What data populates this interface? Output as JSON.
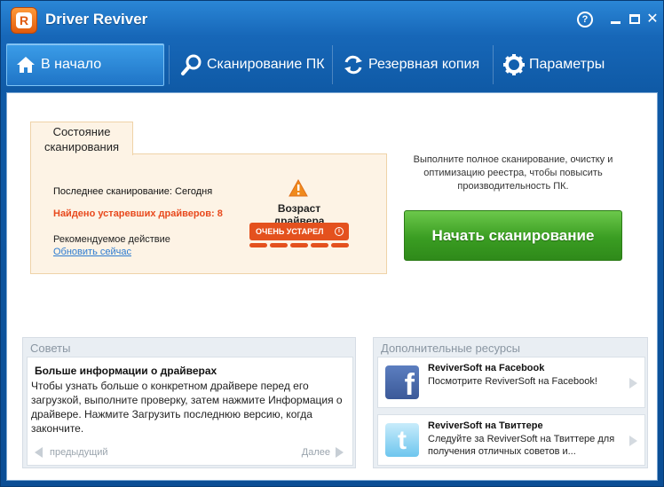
{
  "window": {
    "title": "Driver Reviver",
    "help_label": "?",
    "close_label": "✕"
  },
  "nav": {
    "items": [
      {
        "label": "В начало",
        "icon": "home-icon"
      },
      {
        "label": "Сканирование ПК",
        "icon": "search-icon"
      },
      {
        "label": "Резервная копия",
        "icon": "refresh-icon"
      },
      {
        "label": "Параметры",
        "icon": "gear-icon"
      }
    ]
  },
  "status": {
    "tab_label": "Состояние сканирования",
    "last_scan": "Последнее сканирование: Сегодня",
    "outdated": "Найдено устаревших драйверов: 8",
    "recommended_label": "Рекомендуемое действие",
    "update_link": "Обновить сейчас",
    "driver_age_label": "Возраст драйвера",
    "age_badge": "ОЧЕНЬ УСТАРЕЛ",
    "age_level_segments": 5,
    "age_level_filled": 5
  },
  "scan": {
    "description": "Выполните полное сканирование, очистку и оптимизацию реестра, чтобы повысить производительность ПК.",
    "button_label": "Начать сканирование"
  },
  "tips": {
    "header": "Советы",
    "title": "Больше информации о драйверах",
    "text": "Чтобы узнать больше о конкретном драйвере перед его загрузкой, выполните проверку, затем нажмите Информация о драйвере. Нажмите Загрузить последнюю версию, когда закончите.",
    "prev_label": "предыдущий",
    "next_label": "Далее"
  },
  "resources": {
    "header": "Дополнительные ресурсы",
    "items": [
      {
        "title": "ReviverSoft на Facebook",
        "text": "Посмотрите ReviverSoft на Facebook!",
        "icon": "facebook-icon"
      },
      {
        "title": "ReviverSoft на Твиттере",
        "text": "Следуйте за ReviverSoft на Твиттере для получения отличных советов и...",
        "icon": "twitter-icon"
      }
    ]
  },
  "colors": {
    "accent": "#1767b8",
    "warning": "#e4511e",
    "primary_button": "#3a9d22"
  }
}
